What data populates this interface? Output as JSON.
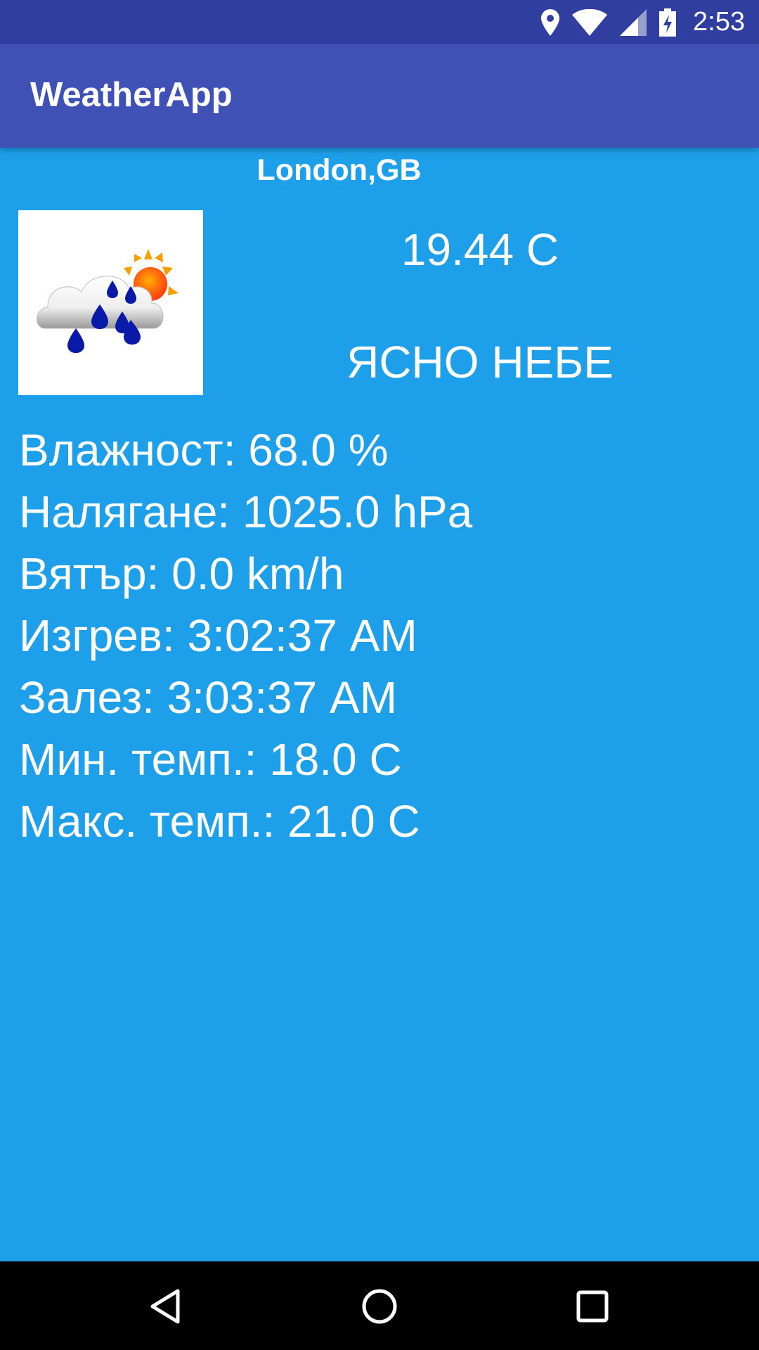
{
  "status_bar": {
    "time": "2:53",
    "icons": [
      "location-icon",
      "wifi-icon",
      "signal-icon",
      "battery-charging-icon"
    ]
  },
  "app_bar": {
    "title": "WeatherApp"
  },
  "weather": {
    "city": "London,GB",
    "icon": "rain-cloud-sun-icon",
    "temperature": "19.44 C",
    "description": "ЯСНО НЕБЕ",
    "details": [
      "Влажност: 68.0 %",
      "Налягане: 1025.0 hPa",
      "Вятър: 0.0 km/h",
      "Изгрев: 3:02:37 AM",
      "Залез: 3:03:37 AM",
      "Мин. темп.: 18.0 C",
      "Макс. темп.: 21.0 C"
    ]
  },
  "nav_bar": {
    "buttons": [
      "back-icon",
      "home-icon",
      "recents-icon"
    ]
  },
  "colors": {
    "status_bar": "#303f9f",
    "app_bar": "#3f51b5",
    "background": "#1e9fea",
    "nav_bar": "#000000"
  }
}
